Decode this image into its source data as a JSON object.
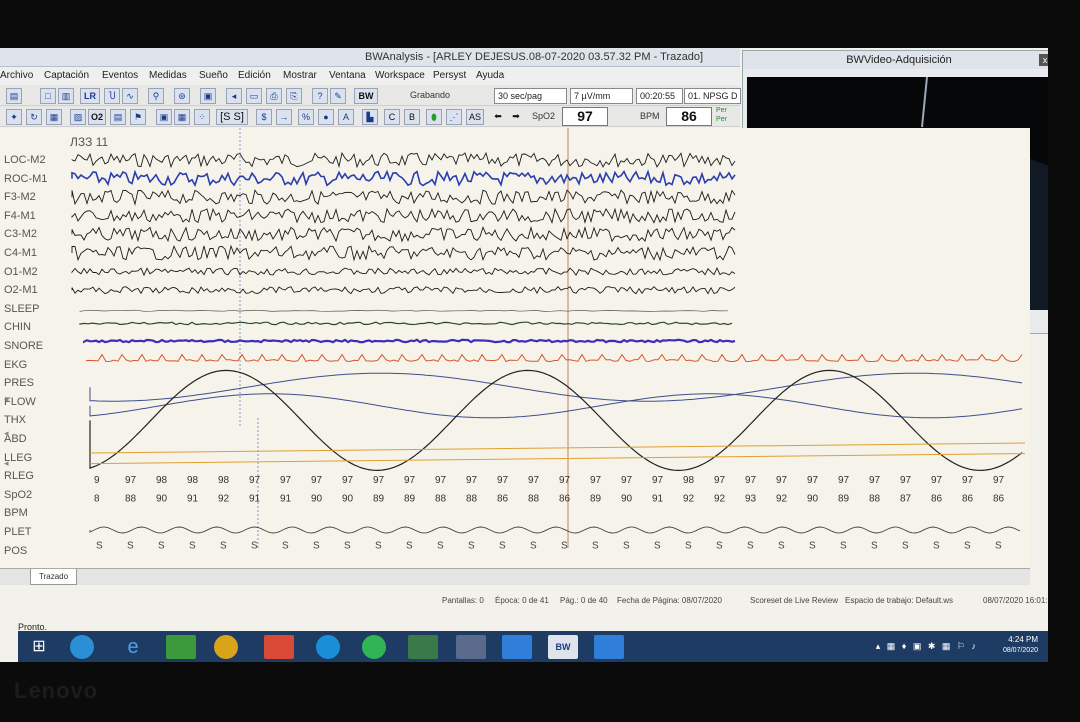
{
  "window": {
    "title": "BWAnalysis - [ARLEY DEJESUS.08-07-2020 03.57.32 PM - Trazado]"
  },
  "menu": [
    "Archivo",
    "Captación",
    "Eventos",
    "Medidas",
    "Sueño",
    "Edición",
    "Mostrar",
    "Ventana",
    "Workspace",
    "Persyst",
    "Ayuda"
  ],
  "toolbar": {
    "lr_label": "LR",
    "bw_label": "BW",
    "recording_status": "Grabando",
    "timebase": "30 sec/pag",
    "sensitivity": "7 µV/mm",
    "time_readout": "00:20:55",
    "montage": "01. NPSG D",
    "spo2_label": "SpO2",
    "spo2_value": "97",
    "bpm_label": "BPM",
    "bpm_value": "86",
    "ss_label": "[S S]",
    "o2_label": "O2",
    "c_label": "C",
    "b_label": "B",
    "as_label": "AS",
    "percent_label": "%",
    "per_a": "Per",
    "per_b": "Per"
  },
  "marker_text": "ЛЗЗ 11",
  "channels": [
    "LOC-M2",
    "ROC-M1",
    "F3-M2",
    "F4-M1",
    "C3-M2",
    "C4-M1",
    "O1-M2",
    "O2-M1",
    "SLEEP",
    "CHIN",
    "SNORE",
    "EKG",
    "PRES",
    "FLOW",
    "THX",
    "ABD",
    "LLEG",
    "RLEG",
    "SpO2",
    "BPM",
    "PLET",
    "POS"
  ],
  "spo2_row": [
    "9",
    "97",
    "98",
    "98",
    "98",
    "97",
    "97",
    "97",
    "97",
    "97",
    "97",
    "97",
    "97",
    "97",
    "97",
    "97",
    "97",
    "97",
    "97",
    "98",
    "97",
    "97",
    "97",
    "97",
    "97",
    "97",
    "97",
    "97",
    "97",
    "97"
  ],
  "bpm_row": [
    "8",
    "88",
    "90",
    "91",
    "92",
    "91",
    "91",
    "90",
    "90",
    "89",
    "89",
    "88",
    "88",
    "86",
    "88",
    "86",
    "89",
    "90",
    "91",
    "92",
    "92",
    "93",
    "92",
    "90",
    "89",
    "88",
    "87",
    "86",
    "86",
    "86"
  ],
  "pos_row": [
    "S",
    "S",
    "S",
    "S",
    "S",
    "S",
    "S",
    "S",
    "S",
    "S",
    "S",
    "S",
    "S",
    "S",
    "S",
    "S",
    "S",
    "S",
    "S",
    "S",
    "S",
    "S",
    "S",
    "S",
    "S",
    "S",
    "S",
    "S",
    "S",
    "S"
  ],
  "tab": "Trazado",
  "status": {
    "screens": "Pantallas: 0",
    "epoch": "Época: 0 de 41",
    "page": "Pág.: 0 de 40",
    "page_date": "Fecha de Página: 08/07/2020",
    "scoreset": "Scoreset de Live Review",
    "workspace": "Espacio de trabajo: Default.ws",
    "datetime": "08/07/2020  16:01:13"
  },
  "ready": "Pronto.",
  "video": {
    "title": "BWVideo-Adquisición",
    "close": "x"
  },
  "clock": {
    "time": "4:24 PM",
    "date": "08/07/2020"
  },
  "brand": "Lenovo",
  "colors": {
    "eeg": "#1a1a1a",
    "roc": "#2a3fae",
    "snore": "#3a2fb8",
    "ekg": "#d9552a",
    "orange_line": "#e0a030",
    "taskbar": "#1d3b63"
  }
}
